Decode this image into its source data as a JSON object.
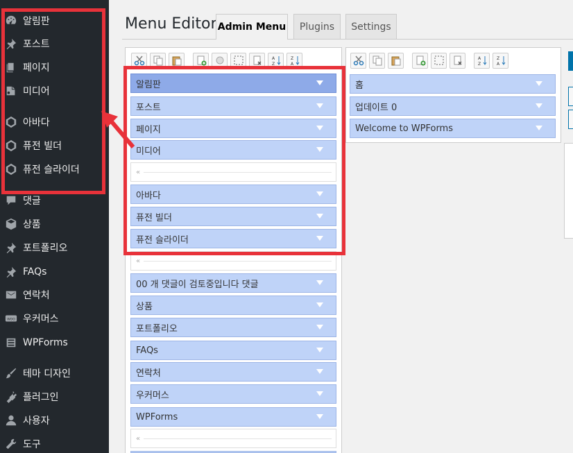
{
  "sidebar": {
    "items": [
      {
        "label": "알림판",
        "icon": "dashboard-icon"
      },
      {
        "label": "포스트",
        "icon": "pin-icon"
      },
      {
        "label": "페이지",
        "icon": "pages-icon"
      },
      {
        "label": "미디어",
        "icon": "media-icon"
      },
      {
        "label": "아바다",
        "icon": "avada-icon"
      },
      {
        "label": "퓨전 빌더",
        "icon": "avada-icon"
      },
      {
        "label": "퓨전 슬라이더",
        "icon": "avada-icon"
      },
      {
        "label": "댓글",
        "icon": "comment-icon"
      },
      {
        "label": "상품",
        "icon": "product-icon"
      },
      {
        "label": "포트폴리오",
        "icon": "pin-icon"
      },
      {
        "label": "FAQs",
        "icon": "pin-icon"
      },
      {
        "label": "연락처",
        "icon": "mail-icon"
      },
      {
        "label": "우커머스",
        "icon": "woo-icon"
      },
      {
        "label": "WPForms",
        "icon": "forms-icon"
      },
      {
        "label": "테마 디자인",
        "icon": "brush-icon"
      },
      {
        "label": "플러그인",
        "icon": "plugin-icon"
      },
      {
        "label": "사용자",
        "icon": "user-icon"
      },
      {
        "label": "도구",
        "icon": "wrench-icon"
      }
    ]
  },
  "header": {
    "title": "Menu Editor",
    "tabs": [
      "Admin Menu",
      "Plugins",
      "Settings"
    ]
  },
  "left_menu": {
    "items": [
      "알림판",
      "포스트",
      "페이지",
      "미디어",
      "",
      "아바다",
      "퓨전 빌더",
      "퓨전 슬라이더",
      "",
      "00 개 댓글이 검토중입니다 댓글",
      "상품",
      "포트폴리오",
      "FAQs",
      "연락처",
      "우커머스",
      "WPForms",
      ""
    ],
    "separator_glyph": "«"
  },
  "right_menu": {
    "items": [
      "홈",
      "업데이트 0",
      "Welcome to WPForms"
    ]
  },
  "colors": {
    "sidebar_bg": "#23282d",
    "menu_item_bg": "#bfd3f8",
    "menu_item_selected_bg": "#8eaae8",
    "annotation_red": "#e8323a"
  }
}
